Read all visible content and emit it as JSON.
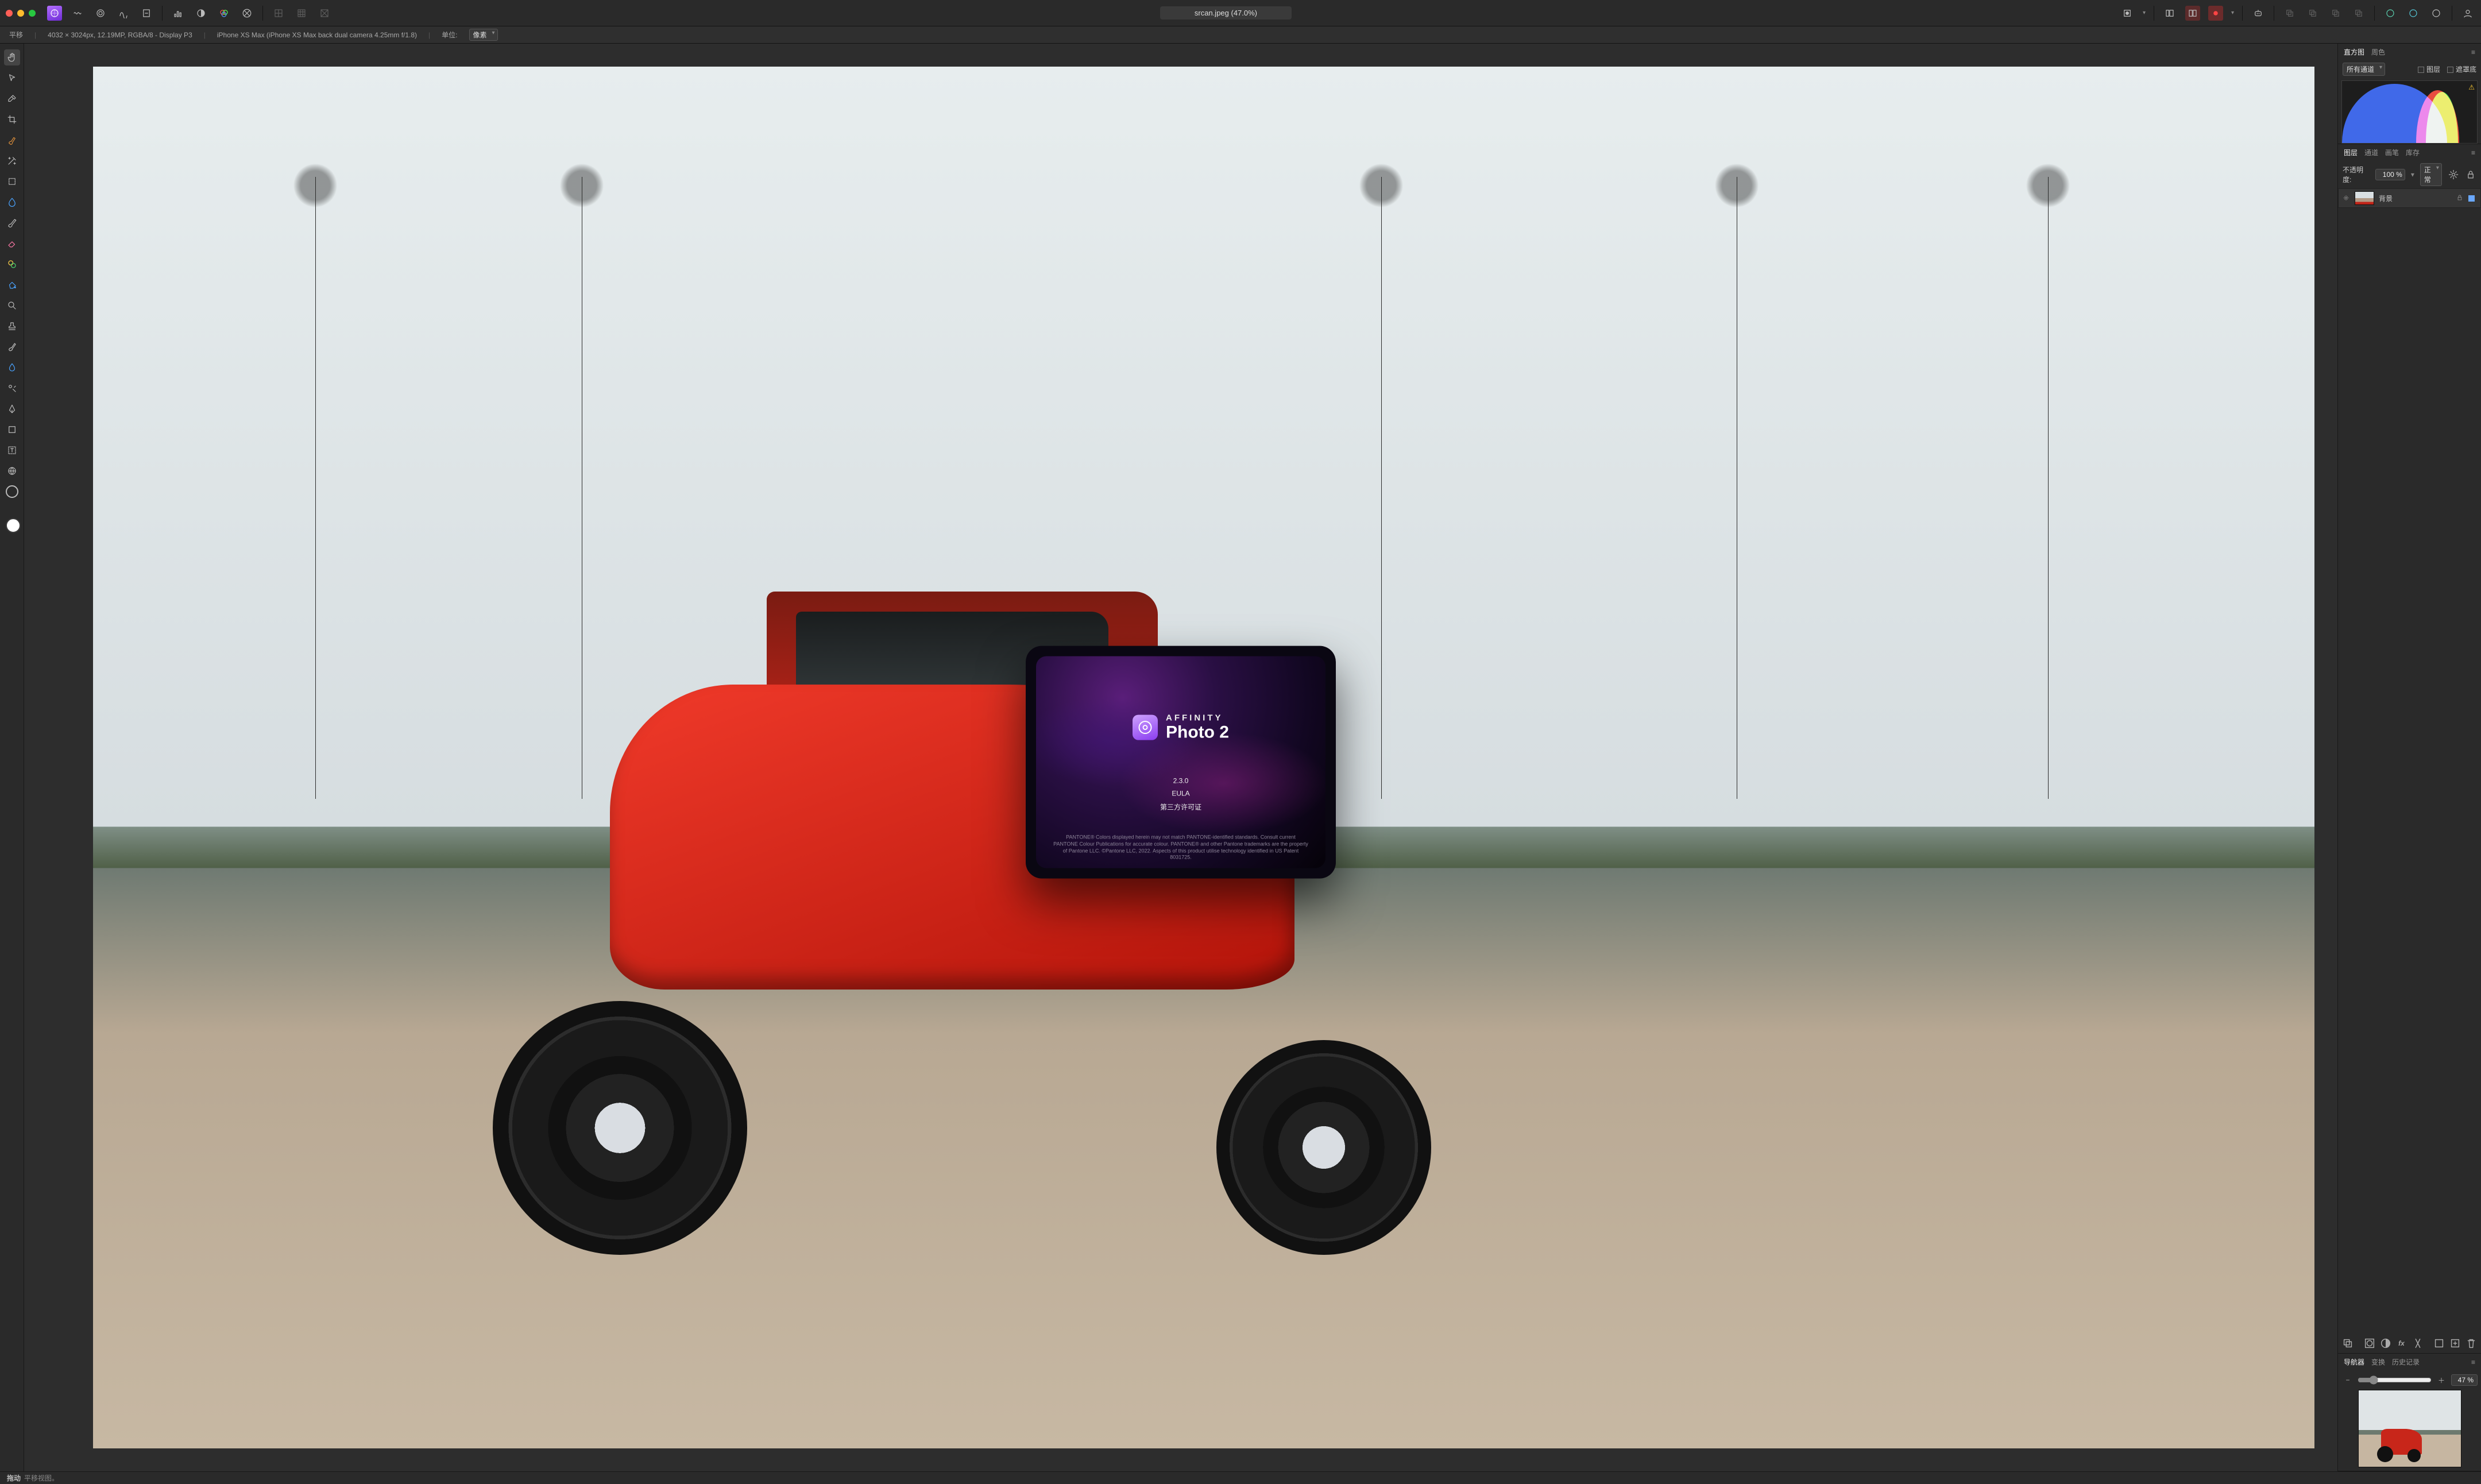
{
  "window": {
    "title": "srcan.jpeg (47.0%)"
  },
  "context": {
    "tool_name": "平移",
    "doc_info": "4032 × 3024px, 12.19MP, RGBA/8 - Display P3",
    "camera": "iPhone XS Max (iPhone XS Max back dual camera 4.25mm f/1.8)",
    "unit_label": "单位:",
    "unit_value": "像素"
  },
  "histogram": {
    "tabs": {
      "histogram": "直方图",
      "scope": "周色"
    },
    "channel": "所有通道",
    "opt_layer": "图层",
    "opt_mask": "遮罩底"
  },
  "layers": {
    "tabs": {
      "layers": "图层",
      "channels": "通道",
      "brushes": "画笔",
      "stock": "库存"
    },
    "opacity_label": "不透明度:",
    "opacity_value": "100 %",
    "blend_mode": "正常",
    "items": [
      {
        "name": "背景"
      }
    ]
  },
  "navigator": {
    "tabs": {
      "navigator": "导航器",
      "transform": "变换",
      "history": "历史记录"
    },
    "zoom": "47 %"
  },
  "splash": {
    "brand_top": "AFFINITY",
    "brand_main": "Photo 2",
    "version": "2.3.0",
    "eula": "EULA",
    "third_party": "第三方许可证",
    "legal": "PANTONE® Colors displayed herein may not match PANTONE-identified standards. Consult current PANTONE Colour Publications for accurate colour. PANTONE® and other Pantone trademarks are the property of Pantone LLC. ©Pantone LLC, 2022. Aspects of this product utilise technology identified in US Patent 8031725."
  },
  "status": {
    "action": "拖动",
    "hint": "平移视图。"
  }
}
